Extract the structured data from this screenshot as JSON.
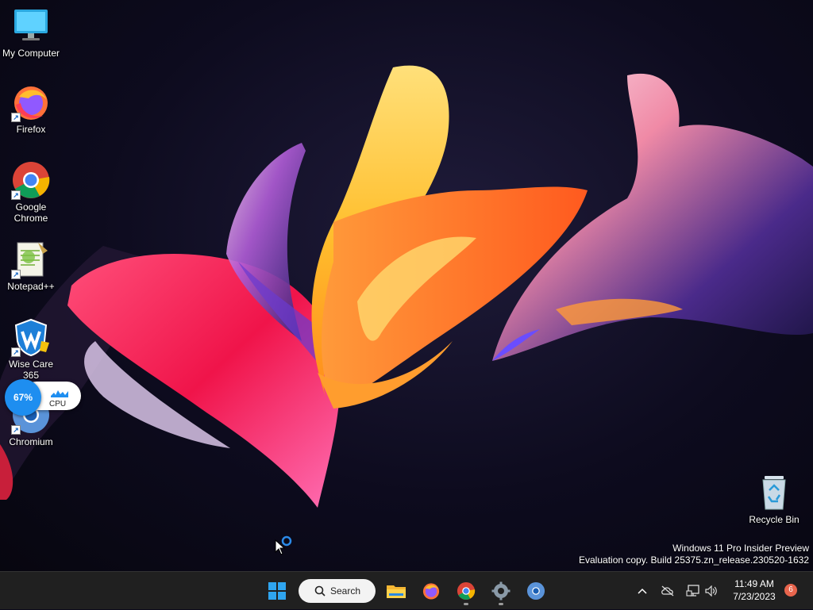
{
  "desktop": {
    "icons": [
      {
        "label": "My Computer",
        "icon": "monitor-icon",
        "shortcut": false
      },
      {
        "label": "Firefox",
        "icon": "firefox-icon",
        "shortcut": true
      },
      {
        "label": "Google Chrome",
        "icon": "chrome-icon",
        "shortcut": true
      },
      {
        "label": "Notepad++",
        "icon": "notepadpp-icon",
        "shortcut": true
      },
      {
        "label": "Wise Care 365",
        "icon": "wisecare-icon",
        "shortcut": true
      },
      {
        "label": "Chromium",
        "icon": "chromium-icon",
        "shortcut": true
      },
      {
        "label": "Recycle Bin",
        "icon": "recycle-bin-icon",
        "shortcut": false
      }
    ],
    "cpu_widget": {
      "percent": "67%",
      "label": "CPU",
      "value": 0.67,
      "color": "#1e8ef0"
    },
    "watermark": {
      "line1": "Windows 11 Pro Insider Preview",
      "line2": "Evaluation copy. Build 25375.zn_release.230520-1632"
    }
  },
  "taskbar": {
    "start_icon": "windows-start-icon",
    "search_label": "Search",
    "apps": [
      {
        "name": "File Explorer",
        "icon": "file-explorer-icon",
        "running": false
      },
      {
        "name": "Firefox",
        "icon": "firefox-icon",
        "running": false
      },
      {
        "name": "Google Chrome",
        "icon": "chrome-icon",
        "running": true
      },
      {
        "name": "Settings",
        "icon": "settings-gear-icon",
        "running": true
      },
      {
        "name": "Chromium",
        "icon": "chromium-icon",
        "running": false
      }
    ],
    "tray": {
      "icons": [
        "chevron-up-icon",
        "cloud-offline-icon",
        "network-icon",
        "volume-icon"
      ],
      "time": "11:49 AM",
      "date": "7/23/2023",
      "notification_count": "6"
    },
    "background": "#202020"
  }
}
